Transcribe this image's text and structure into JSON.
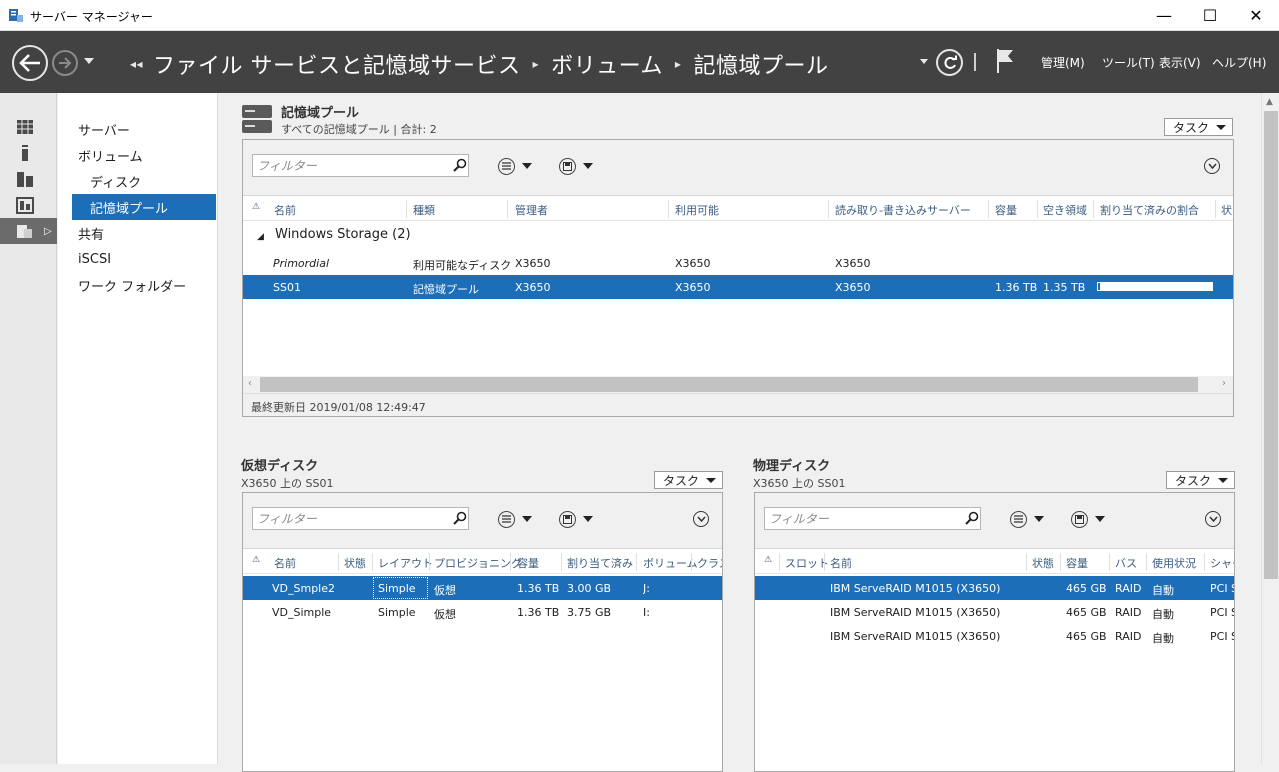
{
  "window": {
    "title": "サーバー マネージャー",
    "minimize": "—",
    "maximize": "☐",
    "close": "✕"
  },
  "header": {
    "crumbs": [
      "ファイル サービスと記憶域サービス",
      "ボリューム",
      "記憶域プール"
    ],
    "menus": [
      "管理(M)",
      "ツール(T)",
      "表示(V)",
      "ヘルプ(H)"
    ]
  },
  "nav": {
    "items": [
      "サーバー",
      "ボリューム",
      "ディスク",
      "記憶域プール",
      "共有",
      "iSCSI",
      "ワーク フォルダー"
    ]
  },
  "pools": {
    "title": "記憶域プール",
    "subtitle": "すべての記憶域プール | 合計: 2",
    "task": "タスク",
    "filter_placeholder": "フィルター",
    "columns": [
      "名前",
      "種類",
      "管理者",
      "利用可能",
      "読み取り-書き込みサーバー",
      "容量",
      "空き領域",
      "割り当て済みの割合",
      "状"
    ],
    "group": "Windows Storage (2)",
    "rows": [
      {
        "name": "Primordial",
        "type": "利用可能なディスク",
        "admin": "X3650",
        "avail": "X3650",
        "rw": "X3650",
        "cap": "",
        "free": "",
        "alloc_pct": null
      },
      {
        "name": "SS01",
        "type": "記憶域プール",
        "admin": "X3650",
        "avail": "X3650",
        "rw": "X3650",
        "cap": "1.36 TB",
        "free": "1.35 TB",
        "alloc_pct": 0.02
      }
    ],
    "last_updated": "最終更新日 2019/01/08 12:49:47"
  },
  "vdisks": {
    "title": "仮想ディスク",
    "subtitle": "X3650 上の SS01",
    "task": "タスク",
    "filter_placeholder": "フィルター",
    "columns": [
      "名前",
      "状態",
      "レイアウト",
      "プロビジョニング",
      "容量",
      "割り当て済み",
      "ボリューム",
      "クラス"
    ],
    "rows": [
      {
        "name": "VD_Smple2",
        "status": "",
        "layout": "Simple",
        "prov": "仮想",
        "cap": "1.36 TB",
        "alloc": "3.00 GB",
        "vol": "J:"
      },
      {
        "name": "VD_Simple",
        "status": "",
        "layout": "Simple",
        "prov": "仮想",
        "cap": "1.36 TB",
        "alloc": "3.75 GB",
        "vol": "I:"
      }
    ]
  },
  "pdisks": {
    "title": "物理ディスク",
    "subtitle": "X3650 上の SS01",
    "task": "タスク",
    "filter_placeholder": "フィルター",
    "columns": [
      "スロット",
      "名前",
      "状態",
      "容量",
      "バス",
      "使用状況",
      "シャー"
    ],
    "rows": [
      {
        "slot": "",
        "name": "IBM ServeRAID M1015 (X3650)",
        "status": "",
        "cap": "465 GB",
        "bus": "RAID",
        "usage": "自動",
        "chassis": "PCI S"
      },
      {
        "slot": "",
        "name": "IBM ServeRAID M1015 (X3650)",
        "status": "",
        "cap": "465 GB",
        "bus": "RAID",
        "usage": "自動",
        "chassis": "PCI S"
      },
      {
        "slot": "",
        "name": "IBM ServeRAID M1015 (X3650)",
        "status": "",
        "cap": "465 GB",
        "bus": "RAID",
        "usage": "自動",
        "chassis": "PCI S"
      }
    ]
  }
}
